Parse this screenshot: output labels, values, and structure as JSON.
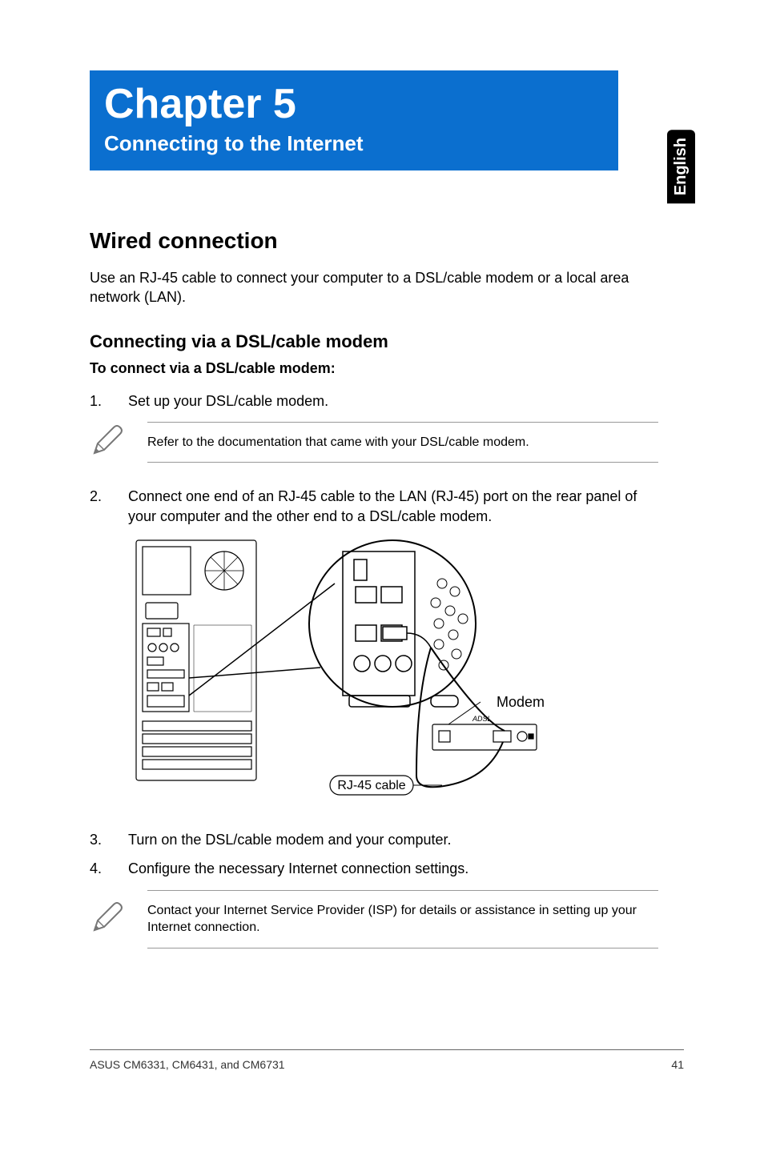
{
  "language_tab": "English",
  "chapter": {
    "title": "Chapter 5",
    "subtitle": "Connecting to the Internet"
  },
  "section": {
    "heading": "Wired connection",
    "intro": "Use an RJ-45 cable to connect your computer to a DSL/cable modem or a local area network (LAN)."
  },
  "subsection": {
    "heading": "Connecting via a DSL/cable modem",
    "lead": "To connect via a DSL/cable modem:"
  },
  "steps": [
    {
      "n": "1.",
      "text": "Set up your DSL/cable modem."
    },
    {
      "n": "2.",
      "text": "Connect one end of an RJ-45 cable to the LAN (RJ-45) port on the rear panel of your computer and the other end to a DSL/cable modem."
    },
    {
      "n": "3.",
      "text": "Turn on the DSL/cable modem and your computer."
    },
    {
      "n": "4.",
      "text": "Configure the necessary Internet connection settings."
    }
  ],
  "notes": {
    "a": "Refer to the documentation that came with your DSL/cable modem.",
    "b": "Contact your Internet Service Provider (ISP) for details or assistance in setting up your Internet connection."
  },
  "diagram_labels": {
    "modem": "Modem",
    "cable": "RJ-45 cable"
  },
  "footer": {
    "left": "ASUS CM6331, CM6431, and CM6731",
    "right": "41"
  }
}
